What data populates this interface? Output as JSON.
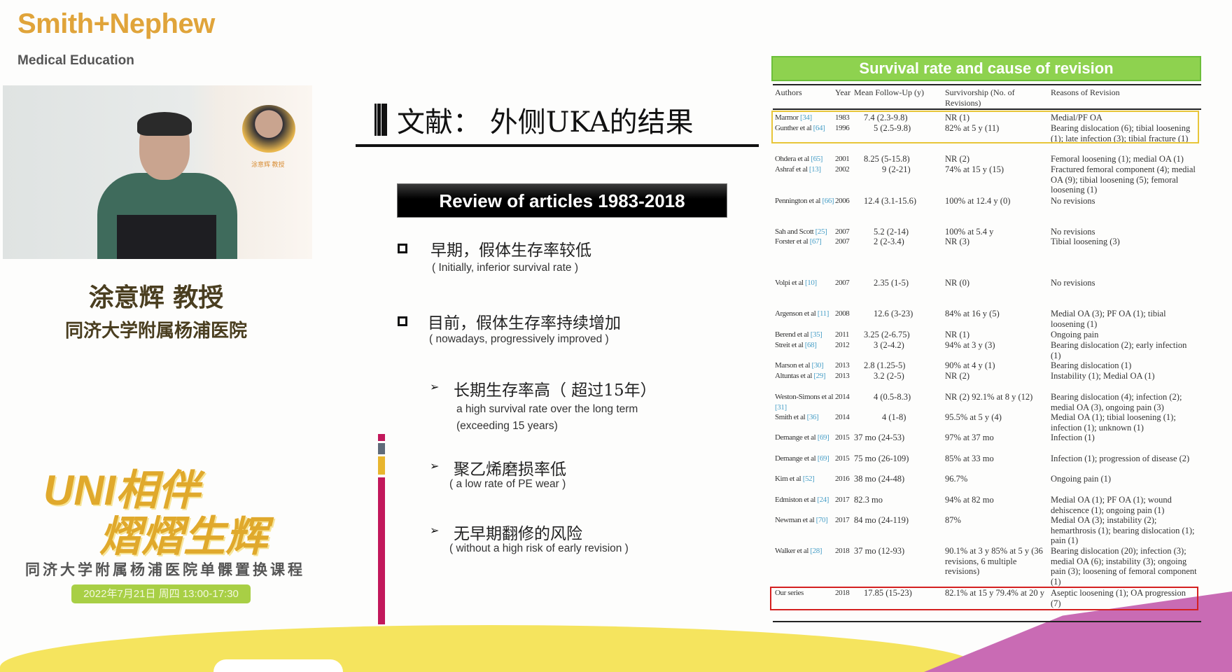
{
  "brand": {
    "logo": "Smith+Nephew",
    "subtitle": "Medical Education"
  },
  "video": {
    "poster_caption": "涂意辉 教授"
  },
  "speaker": {
    "name": "涂意辉  教授",
    "hospital": "同济大学附属杨浦医院"
  },
  "event": {
    "slogan_line1": "UNI相伴",
    "slogan_line2": "熠熠生辉",
    "course": "同济大学附属杨浦医院单髁置换课程",
    "date": "2022年7月21日 周四 13:00-17:30"
  },
  "slide": {
    "title": "文献：  外侧UKA的结果",
    "review_box": "Review of articles 1983-2018",
    "bullets": [
      {
        "zh": "早期，假体生存率较低",
        "en": "( Initially, inferior survival rate )"
      },
      {
        "zh": "目前，假体生存率持续增加",
        "en": "( nowadays, progressively improved )"
      }
    ],
    "sub_bullets": [
      {
        "zh": "长期生存率高（ 超过15年）",
        "en": "a high survival rate over the long term",
        "en2": "(exceeding 15 years)"
      },
      {
        "zh": "聚乙烯磨损率低",
        "en": "( a low rate of PE wear )"
      },
      {
        "zh": "无早期翻修的风险",
        "en": "( without a high risk of early revision )"
      }
    ],
    "bar_colors": [
      "#c2185b",
      "#5f6b7a",
      "#e8b52e",
      "#c2185b"
    ]
  },
  "table": {
    "title": "Survival rate and cause of revision",
    "headers": [
      "Authors",
      "Year",
      "Mean Follow-Up (y)",
      "Survivorship (No. of Revisions)",
      "Reasons of Revision"
    ],
    "rows": [
      {
        "author": "Marmor",
        "ref": "[34]",
        "year": "1983",
        "fu": "7.4 (2.3-9.8)",
        "surv": "NR (1)",
        "reason": "Medial/PF OA"
      },
      {
        "author": "Gunther et al",
        "ref": "[64]",
        "year": "1996",
        "fu": "5 (2.5-9.8)",
        "surv": "82% at 5 y (11)",
        "reason": "Bearing dislocation (6); tibial loosening (1); late infection (3); tibial fracture (1)"
      },
      {
        "author": "Ohdera et al",
        "ref": "[65]",
        "year": "2001",
        "fu": "8.25 (5-15.8)",
        "surv": "NR (2)",
        "reason": "Femoral loosening (1); medial OA (1)"
      },
      {
        "author": "Ashraf et al",
        "ref": "[13]",
        "year": "2002",
        "fu": "9 (2-21)",
        "surv": "74% at 15 y (15)",
        "reason": "Fractured femoral component (4); medial OA (9); tibial loosening (5); femoral loosening (1)"
      },
      {
        "author": "Pennington et al",
        "ref": "[66]",
        "year": "2006",
        "fu": "12.4 (3.1-15.6)",
        "surv": "100% at 12.4 y (0)",
        "reason": "No revisions"
      },
      {
        "author": "Sah and Scott",
        "ref": "[25]",
        "year": "2007",
        "fu": "5.2 (2-14)",
        "surv": "100% at 5.4 y",
        "reason": "No revisions"
      },
      {
        "author": "Forster et al",
        "ref": "[67]",
        "year": "2007",
        "fu": "2 (2-3.4)",
        "surv": "NR (3)",
        "reason": "Tibial loosening (3)"
      },
      {
        "author": "Volpi et al",
        "ref": "[10]",
        "year": "2007",
        "fu": "2.35 (1-5)",
        "surv": "NR (0)",
        "reason": "No revisions"
      },
      {
        "author": "Argenson et al",
        "ref": "[11]",
        "year": "2008",
        "fu": "12.6 (3-23)",
        "surv": "84% at 16 y (5)",
        "reason": "Medial OA (3); PF OA (1); tibial loosening (1)"
      },
      {
        "author": "Berend et al",
        "ref": "[35]",
        "year": "2011",
        "fu": "3.25 (2-6.75)",
        "surv": "NR (1)",
        "reason": "Ongoing pain"
      },
      {
        "author": "Streit et al",
        "ref": "[68]",
        "year": "2012",
        "fu": "3 (2-4.2)",
        "surv": "94% at 3 y (3)",
        "reason": "Bearing dislocation (2); early infection (1)"
      },
      {
        "author": "Marson et al",
        "ref": "[30]",
        "year": "2013",
        "fu": "2.8 (1.25-5)",
        "surv": "90% at 4 y (1)",
        "reason": "Bearing dislocation (1)"
      },
      {
        "author": "Altuntas et al",
        "ref": "[29]",
        "year": "2013",
        "fu": "3.2 (2-5)",
        "surv": "NR (2)",
        "reason": "Instability (1); Medial OA (1)"
      },
      {
        "author": "Weston-Simons et al",
        "ref": "[31]",
        "year": "2014",
        "fu": "4 (0.5-8.3)",
        "surv": "NR (2) 92.1% at 8 y (12)",
        "reason": "Bearing dislocation (4); infection (2); medial OA (3), ongoing pain (3)"
      },
      {
        "author": "Smith et al",
        "ref": "[36]",
        "year": "2014",
        "fu": "4 (1-8)",
        "surv": "95.5% at 5 y (4)",
        "reason": "Medial OA (1); tibial loosening (1); infection (1); unknown (1)"
      },
      {
        "author": "Demange et al",
        "ref": "[69]",
        "year": "2015",
        "fu": "37 mo (24-53)",
        "surv": "97% at 37 mo",
        "reason": "Infection (1)"
      },
      {
        "author": "Demange et al",
        "ref": "[69]",
        "year": "2015",
        "fu": "75 mo (26-109)",
        "surv": "85% at 33 mo",
        "reason": "Infection (1); progression of disease (2)"
      },
      {
        "author": "Kim et al",
        "ref": "[52]",
        "year": "2016",
        "fu": "38 mo (24-48)",
        "surv": "96.7%",
        "reason": "Ongoing pain (1)"
      },
      {
        "author": "Edmiston et al",
        "ref": "[24]",
        "year": "2017",
        "fu": "82.3 mo",
        "surv": "94% at 82 mo",
        "reason": "Medial OA (1); PF OA (1); wound dehiscence (1); ongoing pain (1)"
      },
      {
        "author": "Newman et al",
        "ref": "[70]",
        "year": "2017",
        "fu": "84 mo (24-119)",
        "surv": "87%",
        "reason": "Medial OA (3); instability (2); hemarthrosis (1); bearing dislocation (1); pain (1)"
      },
      {
        "author": "Walker et al",
        "ref": "[28]",
        "year": "2018",
        "fu": "37 mo (12-93)",
        "surv": "90.1% at 3 y 85% at 5 y (36 revisions, 6 multiple revisions)",
        "reason": "Bearing dislocation (20); infection (3); medial OA (6); instability (3); ongoing pain (3); loosening of femoral component (1)"
      },
      {
        "author": "Our series",
        "ref": "",
        "year": "2018",
        "fu": "17.85 (15-23)",
        "surv": "82.1% at 15 y 79.4% at 20 y",
        "reason": "Aseptic loosening (1); OA progression (7)"
      }
    ]
  }
}
